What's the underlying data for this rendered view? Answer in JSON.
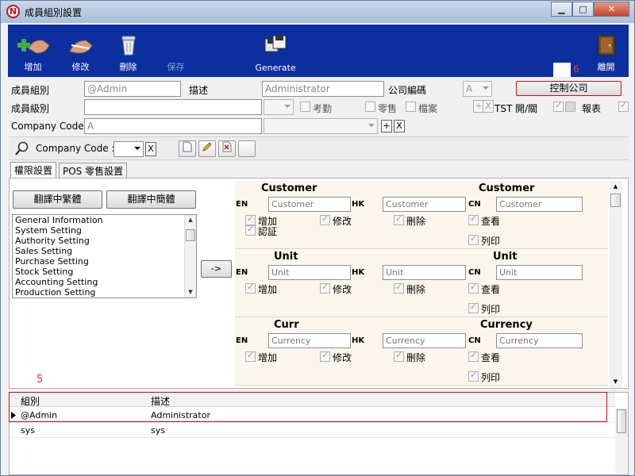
{
  "window": {
    "title": "成員組別設置",
    "min_label": "▁",
    "max_label": "□",
    "close_label": "✕"
  },
  "toolbar": {
    "add": "增加",
    "edit": "修改",
    "delete": "刪除",
    "save": "保存",
    "generate": "Generate",
    "exit": "離開",
    "marker": "6"
  },
  "form": {
    "group_label": "成員組別",
    "group_value": "@Admin",
    "desc_label": "描述",
    "desc_value": "Administrator",
    "company_no_label": "公司編碼",
    "company_no_value": "A",
    "control_company_button": "控制公司",
    "level_label": "成員級別",
    "attendance_label": "考勤",
    "retail_label": "零售",
    "archive_label": "檔案",
    "tst_label": "TST 開/關",
    "report_label": "報表",
    "company_code_label": "Company Code :",
    "company_code_value": "A",
    "plus": "+",
    "x": "X"
  },
  "search": {
    "company_code_label": "Company Code :",
    "x": "X"
  },
  "tabs": [
    {
      "label": "權限設置"
    },
    {
      "label": "POS 零售設置"
    }
  ],
  "translate": {
    "trad": "翻譯中繁體",
    "simp": "翻譯中簡體",
    "arrow": "->"
  },
  "modules": [
    "General Information",
    "System Setting",
    "Authority Setting",
    "Sales Setting",
    "Purchase Setting",
    "Stock Setting",
    "Accounting Setting",
    "Production Setting"
  ],
  "permissions": [
    {
      "en_title": "Customer",
      "cn_title": "Customer",
      "en_value": "Customer",
      "hk_value": "Customer",
      "cn_value": "Customer",
      "extra": "認証"
    },
    {
      "en_title": "Unit",
      "cn_title": "Unit",
      "en_value": "Unit",
      "hk_value": "Unit",
      "cn_value": "Unit",
      "extra": ""
    },
    {
      "en_title": "Curr",
      "cn_title": "Currency",
      "en_value": "Currency",
      "hk_value": "Currency",
      "cn_value": "Currency",
      "extra": ""
    }
  ],
  "perm_labels": {
    "en": "EN",
    "hk": "HK",
    "cn": "CN",
    "add": "增加",
    "edit": "修改",
    "delete": "刪除",
    "view": "查看",
    "print": "列印"
  },
  "grid": {
    "marker": "5",
    "col_group": "組別",
    "col_desc": "描述",
    "rows": [
      {
        "group": "@Admin",
        "desc": "Administrator"
      },
      {
        "group": "sys",
        "desc": "sys"
      }
    ]
  },
  "colors": {
    "toolbar_bg": "#0c2fa0",
    "highlight": "#c8101a",
    "panel_bg": "#fbf6ec"
  }
}
